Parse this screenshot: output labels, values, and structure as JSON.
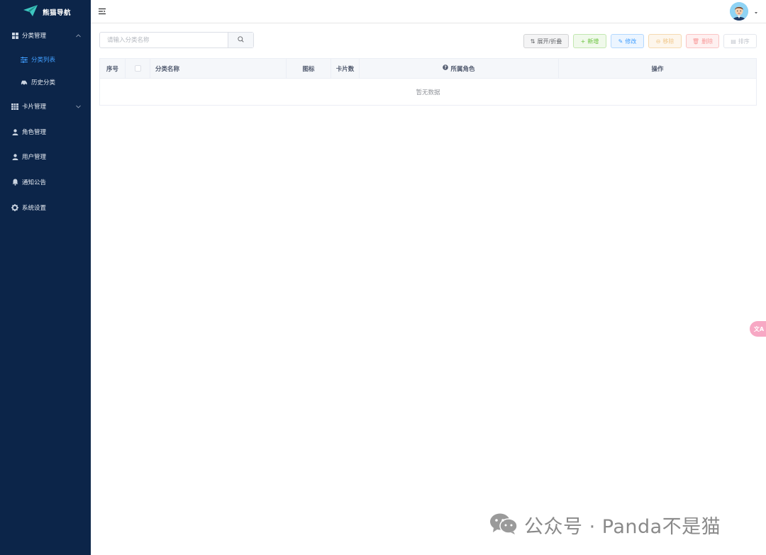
{
  "app": {
    "logo_text": "熊猫导航"
  },
  "sidebar": {
    "items": [
      {
        "label": "分类管理",
        "icon": "grid-icon"
      },
      {
        "label": "分类列表",
        "icon": "sliders-icon",
        "active": true
      },
      {
        "label": "历史分类",
        "icon": "car-icon"
      },
      {
        "label": "卡片管理",
        "icon": "table-icon"
      },
      {
        "label": "角色管理",
        "icon": "user-icon"
      },
      {
        "label": "用户管理",
        "icon": "user-icon"
      },
      {
        "label": "通知公告",
        "icon": "bell-icon"
      },
      {
        "label": "系统设置",
        "icon": "gear-icon"
      }
    ]
  },
  "search": {
    "placeholder": "请输入分类名称"
  },
  "toolbar": {
    "expand_label": "展开/折叠",
    "add_label": "新增",
    "edit_label": "修改",
    "remove_label": "移除",
    "delete_label": "删除",
    "sort_label": "排序"
  },
  "table": {
    "columns": [
      "序号",
      "分类名称",
      "图标",
      "卡片数",
      "所属角色",
      "操作"
    ],
    "empty_text": "暂无数据"
  },
  "floating": {
    "translate_label": "文A"
  },
  "watermark": {
    "text": "公众号 · Panda不是猫"
  },
  "colors": {
    "sidebar_bg": "#0c2549",
    "accent": "#409eff",
    "success": "#67c23a",
    "warning": "#e6a23c",
    "danger": "#f56c6c"
  }
}
